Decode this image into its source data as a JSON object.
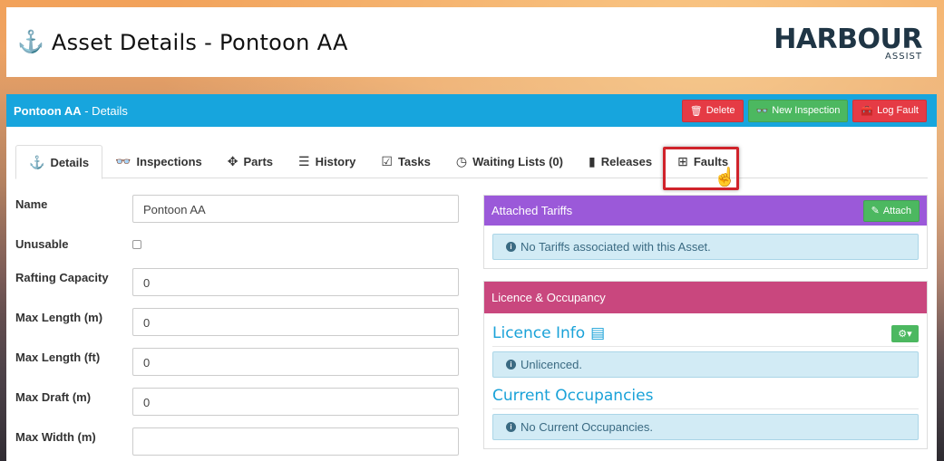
{
  "header": {
    "title": "Asset Details - Pontoon AA",
    "logo_main": "HARBOUR",
    "logo_sub": "ASSIST"
  },
  "panel": {
    "title_bold": "Pontoon AA",
    "title_rest": " - Details",
    "buttons": {
      "delete": "Delete",
      "new_inspection": "New Inspection",
      "log_fault": "Log Fault"
    }
  },
  "tabs": [
    {
      "label": "Details",
      "icon": "anchor-icon"
    },
    {
      "label": "Inspections",
      "icon": "glasses-icon"
    },
    {
      "label": "Parts",
      "icon": "puzzle-icon"
    },
    {
      "label": "History",
      "icon": "layers-icon"
    },
    {
      "label": "Tasks",
      "icon": "checklist-icon"
    },
    {
      "label": "Waiting Lists (0)",
      "icon": "clock-icon"
    },
    {
      "label": "Releases",
      "icon": "door-exit-icon"
    },
    {
      "label": "Faults",
      "icon": "medkit-icon"
    }
  ],
  "form": {
    "name": {
      "label": "Name",
      "value": "Pontoon AA"
    },
    "unusable": {
      "label": "Unusable"
    },
    "rafting": {
      "label": "Rafting Capacity",
      "value": "0"
    },
    "max_length_m": {
      "label": "Max Length (m)",
      "value": "0"
    },
    "max_length_ft": {
      "label": "Max Length (ft)",
      "value": "0"
    },
    "max_draft": {
      "label": "Max Draft (m)",
      "value": "0"
    },
    "max_width": {
      "label": "Max Width (m)",
      "value": ""
    }
  },
  "tariffs": {
    "title": "Attached Tariffs",
    "attach_label": "Attach",
    "empty": "No Tariffs associated with this Asset."
  },
  "licence": {
    "title": "Licence & Occupancy",
    "licence_info": "Licence Info",
    "licence_status": "Unlicenced.",
    "occupancies_title": "Current Occupancies",
    "occupancies_empty": "No Current Occupancies."
  },
  "colors": {
    "panel_heading": "#17a5dd",
    "tariffs_head": "#9b59d9",
    "licence_head": "#c9477e",
    "danger": "#e53b45",
    "success": "#4cb860"
  }
}
